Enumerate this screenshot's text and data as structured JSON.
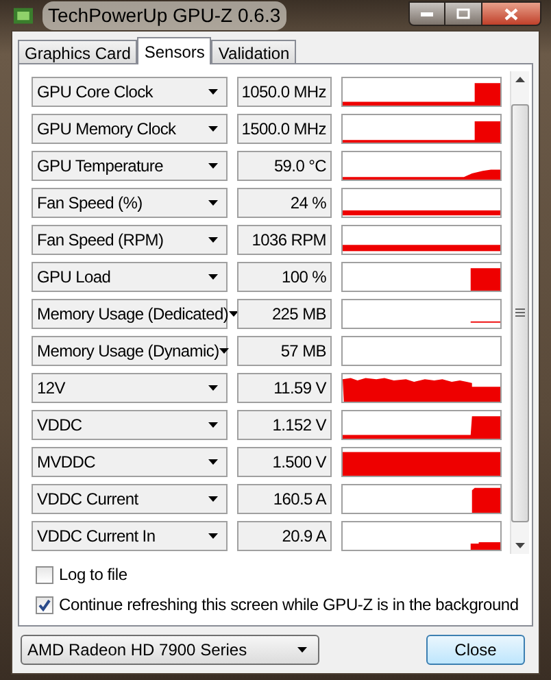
{
  "window": {
    "title": "TechPowerUp GPU-Z 0.6.3"
  },
  "tabs": [
    {
      "label": "Graphics Card",
      "selected": false
    },
    {
      "label": "Sensors",
      "selected": true
    },
    {
      "label": "Validation",
      "selected": false
    }
  ],
  "sensors": [
    {
      "name": "GPU Core Clock",
      "value": "1050.0 MHz"
    },
    {
      "name": "GPU Memory Clock",
      "value": "1500.0 MHz"
    },
    {
      "name": "GPU Temperature",
      "value": "59.0 °C"
    },
    {
      "name": "Fan Speed (%)",
      "value": "24 %"
    },
    {
      "name": "Fan Speed (RPM)",
      "value": "1036 RPM"
    },
    {
      "name": "GPU Load",
      "value": "100 %"
    },
    {
      "name": "Memory Usage (Dedicated)",
      "value": "225 MB"
    },
    {
      "name": "Memory Usage (Dynamic)",
      "value": "57 MB"
    },
    {
      "name": "12V",
      "value": "11.59 V"
    },
    {
      "name": "VDDC",
      "value": "1.152 V"
    },
    {
      "name": "MVDDC",
      "value": "1.500 V"
    },
    {
      "name": "VDDC Current",
      "value": "160.5 A"
    },
    {
      "name": "VDDC Current In",
      "value": "20.9 A"
    }
  ],
  "options": [
    {
      "label": "Log to file",
      "checked": false
    },
    {
      "label": "Continue refreshing this screen while GPU-Z is in the background",
      "checked": true
    }
  ],
  "device_select": {
    "value": "AMD Radeon HD 7900 Series"
  },
  "close_button": {
    "label": "Close"
  }
}
